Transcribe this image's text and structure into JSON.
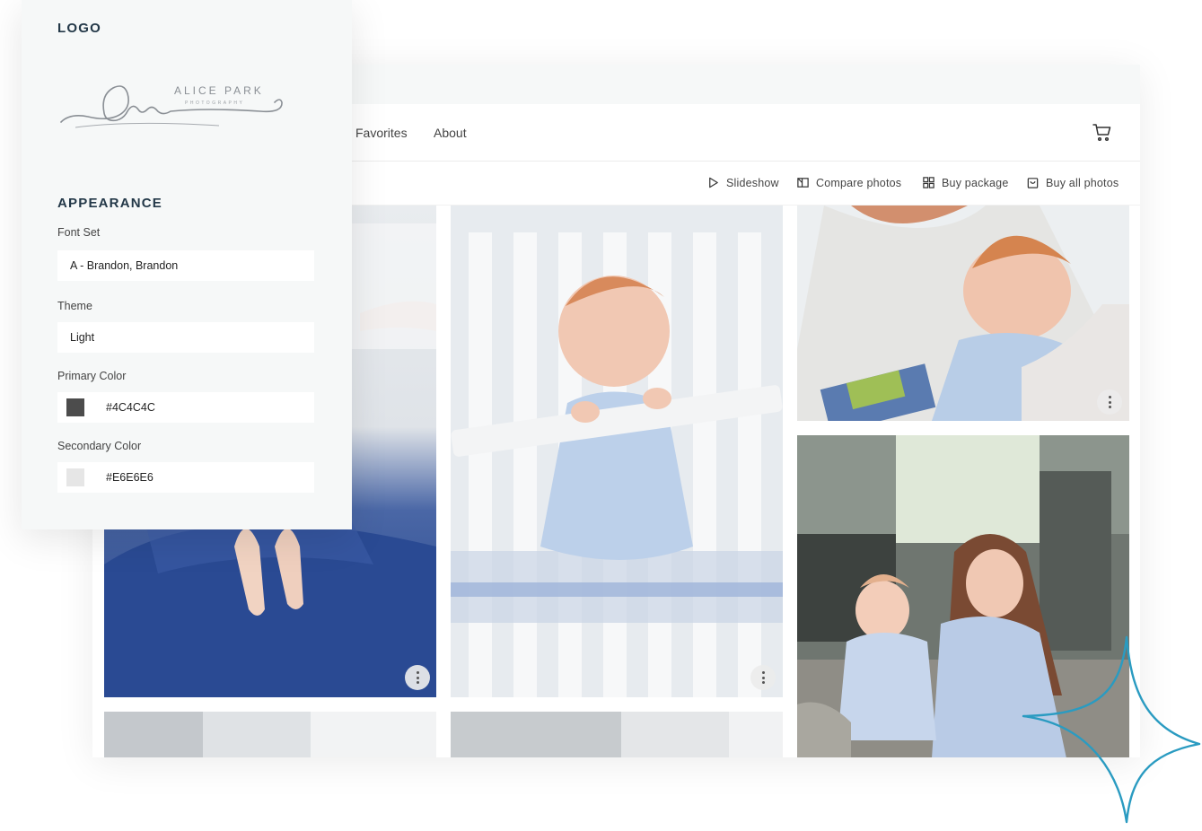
{
  "panel": {
    "logo_heading": "LOGO",
    "logo_text": "ALICE PARK",
    "logo_subtext": "PHOTOGRAPHY",
    "appearance_heading": "APPEARANCE",
    "font_set_label": "Font Set",
    "font_set_value": "A - Brandon, Brandon",
    "theme_label": "Theme",
    "theme_value": "Light",
    "primary_color_label": "Primary Color",
    "primary_color_value": "#4C4C4C",
    "secondary_color_label": "Secondary Color",
    "secondary_color_value": "#E6E6E6"
  },
  "nav": {
    "items": [
      "Favorites",
      "About"
    ]
  },
  "toolbar": {
    "slideshow": "Slideshow",
    "compare": "Compare photos",
    "buy_package": "Buy package",
    "buy_all": "Buy all photos"
  },
  "icons": {
    "cart": "cart-icon",
    "slideshow": "play-icon",
    "compare": "compare-icon",
    "package": "grid-icon",
    "buy_all": "bag-icon",
    "more": "more-vertical-icon",
    "sparkle": "sparkle-icon"
  },
  "colors": {
    "accent": "#2a9bc1",
    "panel_bg": "#f6f8f8",
    "heading": "#233848"
  }
}
